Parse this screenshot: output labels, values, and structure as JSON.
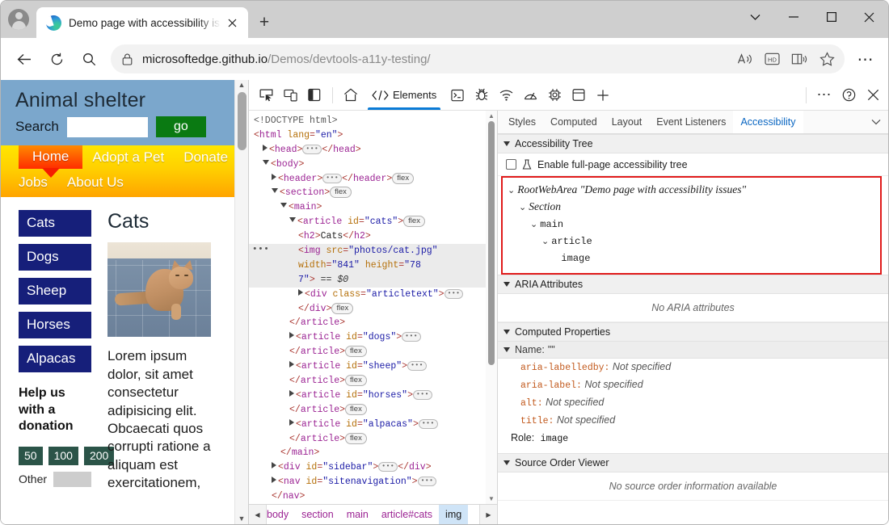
{
  "browser": {
    "tab": {
      "title": "Demo page with accessibility issu",
      "close_label": "×"
    },
    "newtab_label": "+",
    "window_controls": {
      "tab_search": "⌄",
      "minimize": "–",
      "maximize": "☐",
      "close": "×"
    },
    "url": {
      "host": "microsoftedge.github.io",
      "path": "/Demos/devtools-a11y-testing/"
    },
    "toolbar_icons": [
      "read-aloud-icon",
      "hd-icon",
      "immersive-reader-icon",
      "favorite-star-icon",
      "settings-ellipsis-icon"
    ],
    "nav_icons": [
      "back-arrow-icon",
      "refresh-icon",
      "search-icon",
      "lock-icon"
    ]
  },
  "page": {
    "site_title": "Animal shelter",
    "search_label": "Search",
    "search_value": "",
    "go_label": "go",
    "nav_primary": [
      "Home",
      "Adopt a Pet",
      "Donate"
    ],
    "nav_secondary": [
      "Jobs",
      "About Us"
    ],
    "categories": [
      "Cats",
      "Dogs",
      "Sheep",
      "Horses",
      "Alpacas"
    ],
    "help_title": "Help us with a donation",
    "donation_amounts": [
      "50",
      "100",
      "200"
    ],
    "other_label": "Other",
    "other_value": "",
    "article_heading": "Cats",
    "article_text": "Lorem ipsum dolor, sit amet consectetur adipisicing elit. Obcaecati quos corrupti ratione a aliquam est exercitationem,"
  },
  "devtools": {
    "toolbar": {
      "left_icons": [
        "inspect-element-icon",
        "device-emulation-icon",
        "dock-side-icon"
      ],
      "home_icon": "home-icon",
      "active_tab": "Elements",
      "panel_icons": [
        "console-icon",
        "sources-bug-icon",
        "network-wifi-icon",
        "performance-gauge-icon",
        "memory-chip-icon",
        "application-storage-icon"
      ],
      "add_label": "+",
      "right_icons": [
        "more-tools-ellipsis-icon",
        "help-question-icon",
        "close-devtools-icon"
      ]
    },
    "dom_lines": [
      {
        "indent": 0,
        "parts": [
          {
            "c": "cm",
            "t": "<!DOCTYPE html>"
          }
        ]
      },
      {
        "indent": 0,
        "parts": [
          {
            "c": "pk",
            "t": "<"
          },
          {
            "c": "tg",
            "t": "html"
          },
          {
            "c": "at",
            "t": " lang"
          },
          {
            "c": "pk",
            "t": "="
          },
          {
            "c": "av",
            "t": "\"en\""
          },
          {
            "c": "pk",
            "t": ">"
          }
        ]
      },
      {
        "indent": 1,
        "caret": "closed",
        "parts": [
          {
            "c": "pk",
            "t": "<"
          },
          {
            "c": "tg",
            "t": "head"
          },
          {
            "c": "pk",
            "t": ">"
          },
          {
            "c": "dots",
            "t": ""
          },
          {
            "c": "pk",
            "t": "</"
          },
          {
            "c": "tg",
            "t": "head"
          },
          {
            "c": "pk",
            "t": ">"
          }
        ]
      },
      {
        "indent": 1,
        "caret": "open",
        "parts": [
          {
            "c": "pk",
            "t": "<"
          },
          {
            "c": "tg",
            "t": "body"
          },
          {
            "c": "pk",
            "t": ">"
          }
        ]
      },
      {
        "indent": 2,
        "caret": "closed",
        "parts": [
          {
            "c": "pk",
            "t": "<"
          },
          {
            "c": "tg",
            "t": "header"
          },
          {
            "c": "pk",
            "t": ">"
          },
          {
            "c": "dots",
            "t": ""
          },
          {
            "c": "pk",
            "t": "</"
          },
          {
            "c": "tg",
            "t": "header"
          },
          {
            "c": "pk",
            "t": ">"
          },
          {
            "c": "flex",
            "t": "flex"
          }
        ]
      },
      {
        "indent": 2,
        "caret": "open",
        "parts": [
          {
            "c": "pk",
            "t": "<"
          },
          {
            "c": "tg",
            "t": "section"
          },
          {
            "c": "pk",
            "t": ">"
          },
          {
            "c": "flex",
            "t": "flex"
          }
        ]
      },
      {
        "indent": 3,
        "caret": "open",
        "parts": [
          {
            "c": "pk",
            "t": "<"
          },
          {
            "c": "tg",
            "t": "main"
          },
          {
            "c": "pk",
            "t": ">"
          }
        ]
      },
      {
        "indent": 4,
        "caret": "open",
        "parts": [
          {
            "c": "pk",
            "t": "<"
          },
          {
            "c": "tg",
            "t": "article"
          },
          {
            "c": "at",
            "t": " id"
          },
          {
            "c": "pk",
            "t": "="
          },
          {
            "c": "av",
            "t": "\"cats\""
          },
          {
            "c": "pk",
            "t": ">"
          },
          {
            "c": "flex",
            "t": "flex"
          }
        ]
      },
      {
        "indent": 5,
        "parts": [
          {
            "c": "pk",
            "t": "<"
          },
          {
            "c": "tg",
            "t": "h2"
          },
          {
            "c": "pk",
            "t": ">"
          },
          {
            "c": "txt",
            "t": "Cats"
          },
          {
            "c": "pk",
            "t": "</"
          },
          {
            "c": "tg",
            "t": "h2"
          },
          {
            "c": "pk",
            "t": ">"
          }
        ]
      },
      {
        "indent": 5,
        "selected": true,
        "badge": true,
        "parts": [
          {
            "c": "pk",
            "t": "<"
          },
          {
            "c": "tg",
            "t": "img"
          },
          {
            "c": "at",
            "t": " src"
          },
          {
            "c": "pk",
            "t": "="
          },
          {
            "c": "av",
            "t": "\"photos/cat.jpg\""
          }
        ]
      },
      {
        "indent": 5,
        "selected": true,
        "parts": [
          {
            "c": "at",
            "t": "width"
          },
          {
            "c": "pk",
            "t": "="
          },
          {
            "c": "av",
            "t": "\"841\""
          },
          {
            "c": "at",
            "t": " height"
          },
          {
            "c": "pk",
            "t": "="
          },
          {
            "c": "av",
            "t": "\"78"
          }
        ]
      },
      {
        "indent": 5,
        "selected": true,
        "parts": [
          {
            "c": "av",
            "t": "7\""
          },
          {
            "c": "pk",
            "t": ">"
          },
          {
            "c": "dollar",
            "t": " == $0"
          }
        ]
      },
      {
        "indent": 5,
        "caret": "closed",
        "parts": [
          {
            "c": "pk",
            "t": "<"
          },
          {
            "c": "tg",
            "t": "div"
          },
          {
            "c": "at",
            "t": " class"
          },
          {
            "c": "pk",
            "t": "="
          },
          {
            "c": "av",
            "t": "\"articletext\""
          },
          {
            "c": "pk",
            "t": ">"
          },
          {
            "c": "dots",
            "t": ""
          }
        ]
      },
      {
        "indent": 5,
        "parts": [
          {
            "c": "pk",
            "t": "</"
          },
          {
            "c": "tg",
            "t": "div"
          },
          {
            "c": "pk",
            "t": ">"
          },
          {
            "c": "flex",
            "t": "flex"
          }
        ]
      },
      {
        "indent": 4,
        "parts": [
          {
            "c": "pk",
            "t": "</"
          },
          {
            "c": "tg",
            "t": "article"
          },
          {
            "c": "pk",
            "t": ">"
          }
        ]
      },
      {
        "indent": 4,
        "caret": "closed",
        "parts": [
          {
            "c": "pk",
            "t": "<"
          },
          {
            "c": "tg",
            "t": "article"
          },
          {
            "c": "at",
            "t": " id"
          },
          {
            "c": "pk",
            "t": "="
          },
          {
            "c": "av",
            "t": "\"dogs\""
          },
          {
            "c": "pk",
            "t": ">"
          },
          {
            "c": "dots",
            "t": ""
          }
        ]
      },
      {
        "indent": 4,
        "parts": [
          {
            "c": "pk",
            "t": "</"
          },
          {
            "c": "tg",
            "t": "article"
          },
          {
            "c": "pk",
            "t": ">"
          },
          {
            "c": "flex",
            "t": "flex"
          }
        ]
      },
      {
        "indent": 4,
        "caret": "closed",
        "parts": [
          {
            "c": "pk",
            "t": "<"
          },
          {
            "c": "tg",
            "t": "article"
          },
          {
            "c": "at",
            "t": " id"
          },
          {
            "c": "pk",
            "t": "="
          },
          {
            "c": "av",
            "t": "\"sheep\""
          },
          {
            "c": "pk",
            "t": ">"
          },
          {
            "c": "dots",
            "t": ""
          }
        ]
      },
      {
        "indent": 4,
        "parts": [
          {
            "c": "pk",
            "t": "</"
          },
          {
            "c": "tg",
            "t": "article"
          },
          {
            "c": "pk",
            "t": ">"
          },
          {
            "c": "flex",
            "t": "flex"
          }
        ]
      },
      {
        "indent": 4,
        "caret": "closed",
        "parts": [
          {
            "c": "pk",
            "t": "<"
          },
          {
            "c": "tg",
            "t": "article"
          },
          {
            "c": "at",
            "t": " id"
          },
          {
            "c": "pk",
            "t": "="
          },
          {
            "c": "av",
            "t": "\"horses\""
          },
          {
            "c": "pk",
            "t": ">"
          },
          {
            "c": "dots",
            "t": ""
          }
        ]
      },
      {
        "indent": 4,
        "parts": [
          {
            "c": "pk",
            "t": "</"
          },
          {
            "c": "tg",
            "t": "article"
          },
          {
            "c": "pk",
            "t": ">"
          },
          {
            "c": "flex",
            "t": "flex"
          }
        ]
      },
      {
        "indent": 4,
        "caret": "closed",
        "parts": [
          {
            "c": "pk",
            "t": "<"
          },
          {
            "c": "tg",
            "t": "article"
          },
          {
            "c": "at",
            "t": " id"
          },
          {
            "c": "pk",
            "t": "="
          },
          {
            "c": "av",
            "t": "\"alpacas\""
          },
          {
            "c": "pk",
            "t": ">"
          },
          {
            "c": "dots",
            "t": ""
          }
        ]
      },
      {
        "indent": 4,
        "parts": [
          {
            "c": "pk",
            "t": "</"
          },
          {
            "c": "tg",
            "t": "article"
          },
          {
            "c": "pk",
            "t": ">"
          },
          {
            "c": "flex",
            "t": "flex"
          }
        ]
      },
      {
        "indent": 3,
        "parts": [
          {
            "c": "pk",
            "t": "</"
          },
          {
            "c": "tg",
            "t": "main"
          },
          {
            "c": "pk",
            "t": ">"
          }
        ]
      },
      {
        "indent": 2,
        "caret": "closed",
        "parts": [
          {
            "c": "pk",
            "t": "<"
          },
          {
            "c": "tg",
            "t": "div"
          },
          {
            "c": "at",
            "t": " id"
          },
          {
            "c": "pk",
            "t": "="
          },
          {
            "c": "av",
            "t": "\"sidebar\""
          },
          {
            "c": "pk",
            "t": ">"
          },
          {
            "c": "dots",
            "t": ""
          },
          {
            "c": "pk",
            "t": "</"
          },
          {
            "c": "tg",
            "t": "div"
          },
          {
            "c": "pk",
            "t": ">"
          }
        ]
      },
      {
        "indent": 2,
        "caret": "closed",
        "parts": [
          {
            "c": "pk",
            "t": "<"
          },
          {
            "c": "tg",
            "t": "nav"
          },
          {
            "c": "at",
            "t": " id"
          },
          {
            "c": "pk",
            "t": "="
          },
          {
            "c": "av",
            "t": "\"sitenavigation\""
          },
          {
            "c": "pk",
            "t": ">"
          },
          {
            "c": "dots",
            "t": ""
          }
        ]
      },
      {
        "indent": 2,
        "parts": [
          {
            "c": "pk",
            "t": "</"
          },
          {
            "c": "tg",
            "t": "nav"
          },
          {
            "c": "pk",
            "t": ">"
          }
        ]
      }
    ],
    "breadcrumb": [
      "body",
      "section",
      "main",
      "article#cats",
      "img"
    ],
    "breadcrumb_active": "img",
    "a11y_tabs": [
      "Styles",
      "Computed",
      "Layout",
      "Event Listeners",
      "Accessibility"
    ],
    "a11y_active_tab": "Accessibility",
    "sections": {
      "tree_title": "Accessibility Tree",
      "aria_title": "ARIA Attributes",
      "computed_title": "Computed Properties",
      "source_order_title": "Source Order Viewer"
    },
    "enable_fullpage_label": "Enable full-page accessibility tree",
    "enable_fullpage_checked": false,
    "a11y_tree": [
      {
        "indent": 0,
        "caret": true,
        "role": "RootWebArea",
        "name": "\"Demo page with accessibility issues\"",
        "style": "italic"
      },
      {
        "indent": 1,
        "caret": true,
        "role": "Section",
        "name": "",
        "style": "italic"
      },
      {
        "indent": 2,
        "caret": true,
        "role": "main",
        "name": "",
        "style": "mono"
      },
      {
        "indent": 3,
        "caret": true,
        "role": "article",
        "name": "",
        "style": "mono"
      },
      {
        "indent": 4,
        "caret": false,
        "role": "image",
        "name": "",
        "style": "mono"
      }
    ],
    "no_aria_text": "No ARIA attributes",
    "computed_name_label": "Name:",
    "computed_name_value": "\"\"",
    "computed_props": [
      {
        "key": "aria-labelledby",
        "value": "Not specified"
      },
      {
        "key": "aria-label",
        "value": "Not specified"
      },
      {
        "key": "alt",
        "value": "Not specified"
      },
      {
        "key": "title",
        "value": "Not specified"
      }
    ],
    "role_label": "Role:",
    "role_value": "image",
    "no_source_order_text": "No source order information available"
  },
  "colors": {
    "accent": "#0a7bd6",
    "highlight_box": "#e01b1b",
    "site_header": "#7ba7cc",
    "category_btn": "#161f7a",
    "donate_btn": "#2b5448",
    "go_btn": "#0a7a12"
  }
}
